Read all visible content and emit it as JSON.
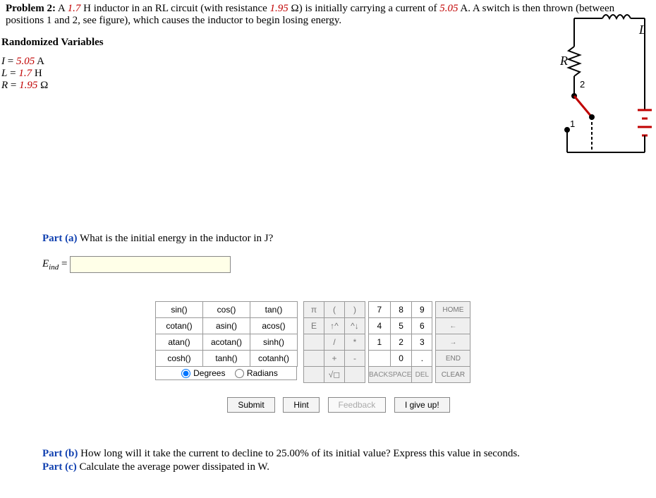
{
  "problem": {
    "title": "Problem 2:",
    "text_before_L": "A ",
    "L_val": "1.7",
    "text_mid1": " H inductor in an RL circuit (with resistance ",
    "R_val": "1.95",
    "text_mid2": " Ω) is initially carrying a current of ",
    "I_val": "5.05",
    "text_end": " A. A switch is then thrown (between positions 1 and 2, see figure), which causes the inductor to begin losing energy."
  },
  "randvars": {
    "title": "Randomized Variables",
    "I_label": "I",
    "I_eq": " = ",
    "I_val": "5.05",
    "I_unit": " A",
    "L_label": "L",
    "L_eq": " = ",
    "L_val": "1.7",
    "L_unit": " H",
    "R_label": "R",
    "R_eq": " = ",
    "R_val": "1.95",
    "R_unit": " Ω"
  },
  "circuit": {
    "R": "R",
    "L": "L",
    "one": "1",
    "two": "2"
  },
  "part_a": {
    "label": "Part (a)",
    "question": "  What is the initial energy in the inductor in J?",
    "answer_sym": "E",
    "answer_sub": "ind",
    "answer_eq": " = "
  },
  "keypad": {
    "funcs": [
      [
        "sin()",
        "cos()",
        "tan()"
      ],
      [
        "cotan()",
        "asin()",
        "acos()"
      ],
      [
        "atan()",
        "acotan()",
        "sinh()"
      ],
      [
        "cosh()",
        "tanh()",
        "cotanh()"
      ]
    ],
    "deg": "Degrees",
    "rad": "Radians",
    "sym": [
      [
        "π",
        "(",
        ")"
      ],
      [
        "E",
        "↑^",
        "^↓"
      ],
      [
        "",
        "/",
        "*"
      ],
      [
        "",
        "+",
        "-"
      ],
      [
        "",
        "√◻",
        ""
      ]
    ],
    "nums": [
      [
        "7",
        "8",
        "9"
      ],
      [
        "4",
        "5",
        "6"
      ],
      [
        "1",
        "2",
        "3"
      ],
      [
        "",
        "0",
        "."
      ]
    ],
    "backspace": "BACKSPACE",
    "del": "DEL",
    "nav": [
      "HOME",
      "←",
      "→",
      "END",
      "CLEAR"
    ]
  },
  "actions": {
    "submit": "Submit",
    "hint": "Hint",
    "feedback": "Feedback",
    "giveup": "I give up!"
  },
  "part_b": {
    "label": "Part (b)",
    "text": "  How long will it take the current to decline to 25.00% of its initial value? Express this value in seconds."
  },
  "part_c": {
    "label": "Part (c)",
    "text": "  Calculate the average power dissipated in W."
  }
}
